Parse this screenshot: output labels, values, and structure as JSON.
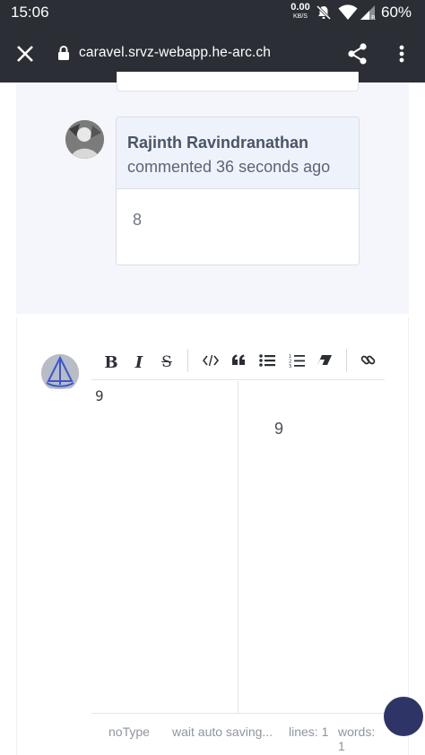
{
  "status_bar": {
    "time": "15:06",
    "net_speed_value": "0.00",
    "net_speed_unit": "KB/S",
    "battery": "60%",
    "icons": [
      "mute-icon",
      "wifi-icon",
      "signal-icon"
    ]
  },
  "url_bar": {
    "url": "caravel.srvz-webapp.he-arc.ch",
    "icons": [
      "close-icon",
      "lock-icon",
      "share-icon",
      "more-vert-icon"
    ]
  },
  "comment": {
    "author": "Rajinth Ravindranathan",
    "meta": "commented 36 seconds ago",
    "body": "8"
  },
  "editor": {
    "toolbar": [
      "bold",
      "italic",
      "strikethrough",
      "code",
      "quote",
      "bullet-list",
      "ordered-list",
      "eraser",
      "link"
    ],
    "toolbar_labels": {
      "bold": "B",
      "italic": "I",
      "strike": "S"
    },
    "source_text": "9",
    "preview_text": "9",
    "status": {
      "type": "noType",
      "saving": "wait auto saving...",
      "lines": "lines: 1",
      "words": "words: 1"
    }
  },
  "colors": {
    "chrome": "#2b2f35",
    "panel": "#f4f6fb",
    "card_header": "#eef3fb",
    "fab": "#2e3566"
  }
}
